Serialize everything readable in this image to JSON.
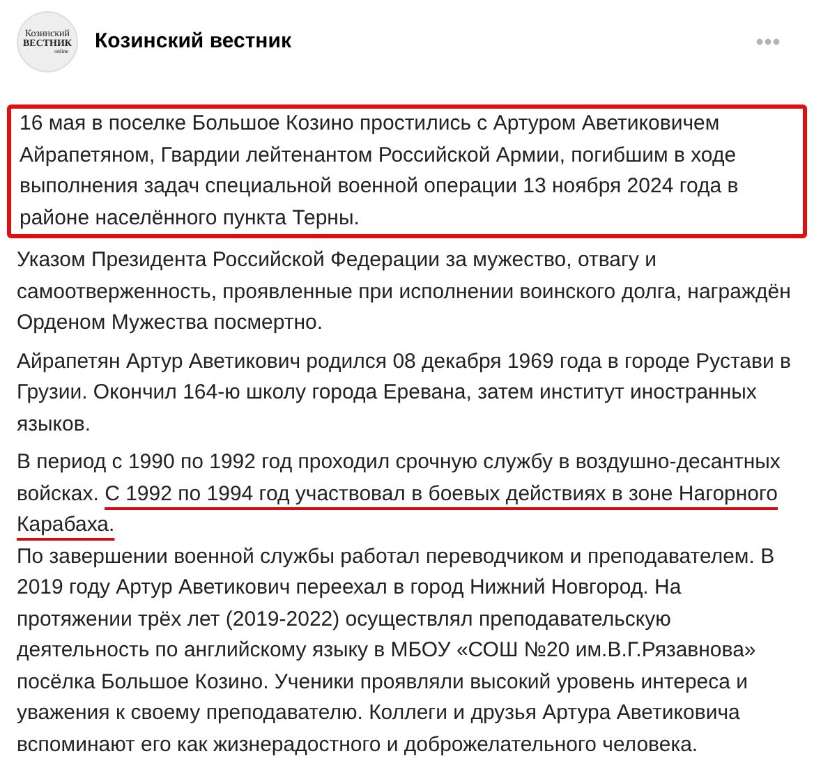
{
  "header": {
    "logo_lines": [
      "Козинский",
      "ВЕСТНИК",
      "online"
    ],
    "title": "Козинский вестник"
  },
  "paragraphs": [
    {
      "boxed": true,
      "segments": [
        {
          "text": "16 мая в поселке Большое Козино простились с Артуром Аветиковичем Айрапетяном, Гвардии лейтенантом Российской Армии, погибшим в ходе выполнения задач специальной военной операции 13 ноября 2024 года в районе населённого пункта Терны.",
          "underlined": false
        }
      ]
    },
    {
      "boxed": false,
      "segments": [
        {
          "text": "Указом Президента Российской Федерации за мужество, отвагу и самоотверженность, проявленные при исполнении воинского долга, награждён Орденом Мужества посмертно.",
          "underlined": false
        }
      ]
    },
    {
      "boxed": false,
      "segments": [
        {
          "text": "Айрапетян Артур Аветикович родился 08 декабря 1969 года в городе Рустави в Грузии. Окончил 164-ю школу города Еревана, затем институт иностранных языков.",
          "underlined": false
        }
      ]
    },
    {
      "boxed": false,
      "segments": [
        {
          "text": "В период с 1990 по 1992 год проходил срочную службу в воздушно-десантных войсках. ",
          "underlined": false
        },
        {
          "text": "С 1992 по 1994 год участвовал в боевых действиях в зоне Нагорного Карабаха.",
          "underlined": true
        },
        {
          "text": "\nПо завершении военной службы работал переводчиком и преподавателем. В 2019 году Артур Аветикович переехал в город Нижний Новгород. На протяжении трёх лет (2019-2022) осуществлял преподавательскую деятельность по английскому языку в МБОУ «СОШ №20 им.В.Г.Рязавнова» посёлка Большое Козино. Ученики проявляли высокий уровень интереса и уважения к своему преподавателю. Коллеги и друзья Артура Аветиковича вспоминают его как жизнерадостного и доброжелательного человека.",
          "underlined": false
        }
      ]
    }
  ]
}
